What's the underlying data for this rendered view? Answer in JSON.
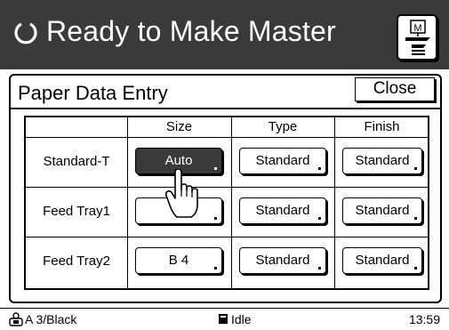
{
  "header": {
    "title": "Ready to Make Master",
    "status_icon": "refresh-circle-icon",
    "master_icon": "master-making-icon",
    "master_icon_letter": "M"
  },
  "panel": {
    "title": "Paper Data Entry",
    "close_label": "Close"
  },
  "table": {
    "columns": [
      "Size",
      "Type",
      "Finish"
    ],
    "rows": [
      {
        "label": "Standard-T",
        "size": "Auto",
        "type": "Standard",
        "finish": "Standard",
        "size_selected": true
      },
      {
        "label": "Feed Tray1",
        "size": "",
        "type": "Standard",
        "finish": "Standard",
        "size_selected": false
      },
      {
        "label": "Feed Tray2",
        "size": "B 4",
        "type": "Standard",
        "finish": "Standard",
        "size_selected": false
      }
    ]
  },
  "status_bar": {
    "paper_icon": "paper-tray-icon",
    "paper_info": "A 3/Black",
    "idle_icon": "idle-icon",
    "state": "Idle",
    "time": "13:59"
  },
  "colors": {
    "header_bg": "#3a3a3a",
    "selected_bg": "#3a3a3a",
    "foreground": "#000000",
    "background": "#ffffff"
  }
}
